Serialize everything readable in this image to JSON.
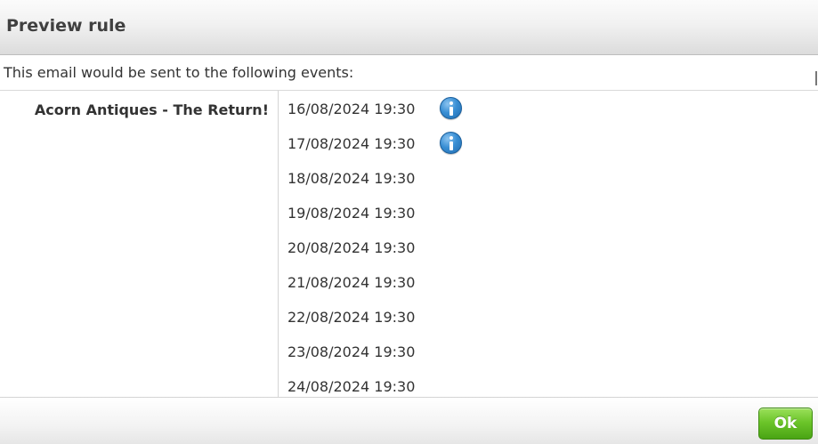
{
  "dialog": {
    "title": "Preview rule",
    "intro": "This email would be sent to the following events:"
  },
  "event": {
    "name": "Acorn Antiques - The Return!",
    "dates": [
      {
        "label": "16/08/2024 19:30",
        "has_info": true
      },
      {
        "label": "17/08/2024 19:30",
        "has_info": true
      },
      {
        "label": "18/08/2024 19:30",
        "has_info": false
      },
      {
        "label": "19/08/2024 19:30",
        "has_info": false
      },
      {
        "label": "20/08/2024 19:30",
        "has_info": false
      },
      {
        "label": "21/08/2024 19:30",
        "has_info": false
      },
      {
        "label": "22/08/2024 19:30",
        "has_info": false
      },
      {
        "label": "23/08/2024 19:30",
        "has_info": false
      },
      {
        "label": "24/08/2024 19:30",
        "has_info": false
      }
    ]
  },
  "footer": {
    "ok_label": "Ok"
  },
  "icons": {
    "info": "info-icon"
  },
  "colors": {
    "ok_button": "#6cc52a",
    "info_icon": "#2f80c8"
  }
}
